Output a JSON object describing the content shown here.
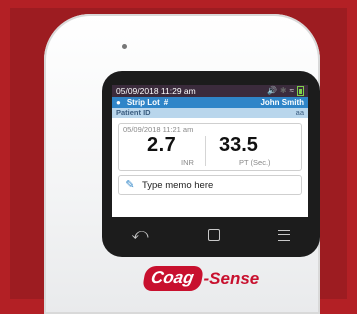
{
  "status": {
    "datetime": "05/09/2018 11:29 am"
  },
  "strip": {
    "label": "Strip Lot",
    "hash": "#",
    "user": "John Smith"
  },
  "patient": {
    "label": "Patient ID",
    "value": "aa"
  },
  "result": {
    "timestamp": "05/09/2018   11:21 am",
    "inr_value": "2.7",
    "inr_label": "INR",
    "pt_value": "33.5",
    "pt_label": "PT (Sec.)"
  },
  "memo": {
    "placeholder": "Type memo here"
  },
  "nav": {
    "back": "⤺"
  },
  "logo": {
    "part1": "Coag",
    "part2": "-Sense"
  },
  "colors": {
    "status_bar": "#3b2b3c",
    "strip_bar": "#2f85c8",
    "patient_bar": "#b9d6ec",
    "brand": "#c8102e",
    "frame": "#b32025"
  }
}
